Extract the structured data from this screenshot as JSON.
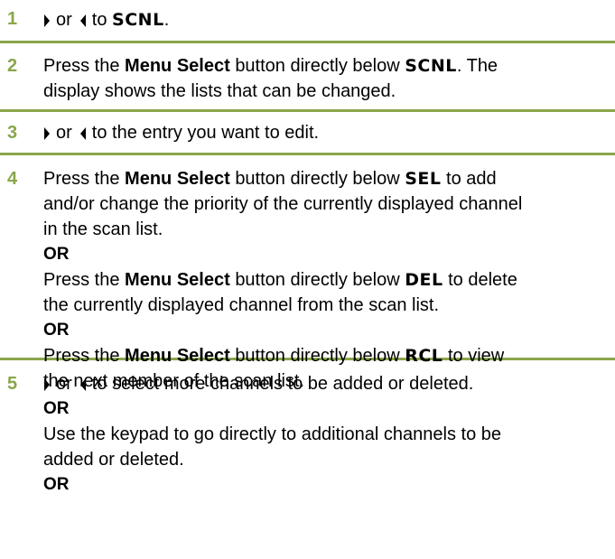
{
  "steps": [
    {
      "number": "1",
      "text_or": "or",
      "text_to": "to",
      "lcd": "SCNL",
      "tail": "."
    },
    {
      "number": "2",
      "pre": "Press the",
      "button": "Menu Select",
      "mid": "button directly below",
      "lcd": "SCNL",
      "post": ". The",
      "line2": "display shows the lists that can be changed."
    },
    {
      "number": "3",
      "text_or": "or",
      "rest": "to the entry you want to edit."
    },
    {
      "number": "4",
      "a_pre": "Press the",
      "a_button": "Menu Select",
      "a_mid": "button directly below",
      "a_lcd": "SEL",
      "a_post": "to add",
      "a_line2": "and/or change the priority of the currently displayed channel",
      "a_line3": "in the scan list.",
      "or1": "OR",
      "b_pre": "Press the",
      "b_button": "Menu Select",
      "b_mid": "button directly below",
      "b_lcd": "DEL",
      "b_post": "to delete",
      "b_line2": "the currently displayed channel from the scan list.",
      "or2": "OR",
      "c_pre": "Press the",
      "c_button": "Menu Select",
      "c_mid": "button directly below",
      "c_lcd": "RCL",
      "c_post": "to view",
      "c_line2": "the next member of the scan list."
    },
    {
      "number": "5",
      "text_or": "or",
      "rest": "to select more channels to be added or deleted.",
      "or1": "OR",
      "line_a": "Use the keypad to go directly to additional channels to be",
      "line_b": "added or deleted.",
      "or2": "OR"
    }
  ],
  "colors": {
    "accent": "#8aa64b"
  },
  "icons": {
    "right": "right-arrow-icon",
    "left": "left-arrow-icon"
  }
}
